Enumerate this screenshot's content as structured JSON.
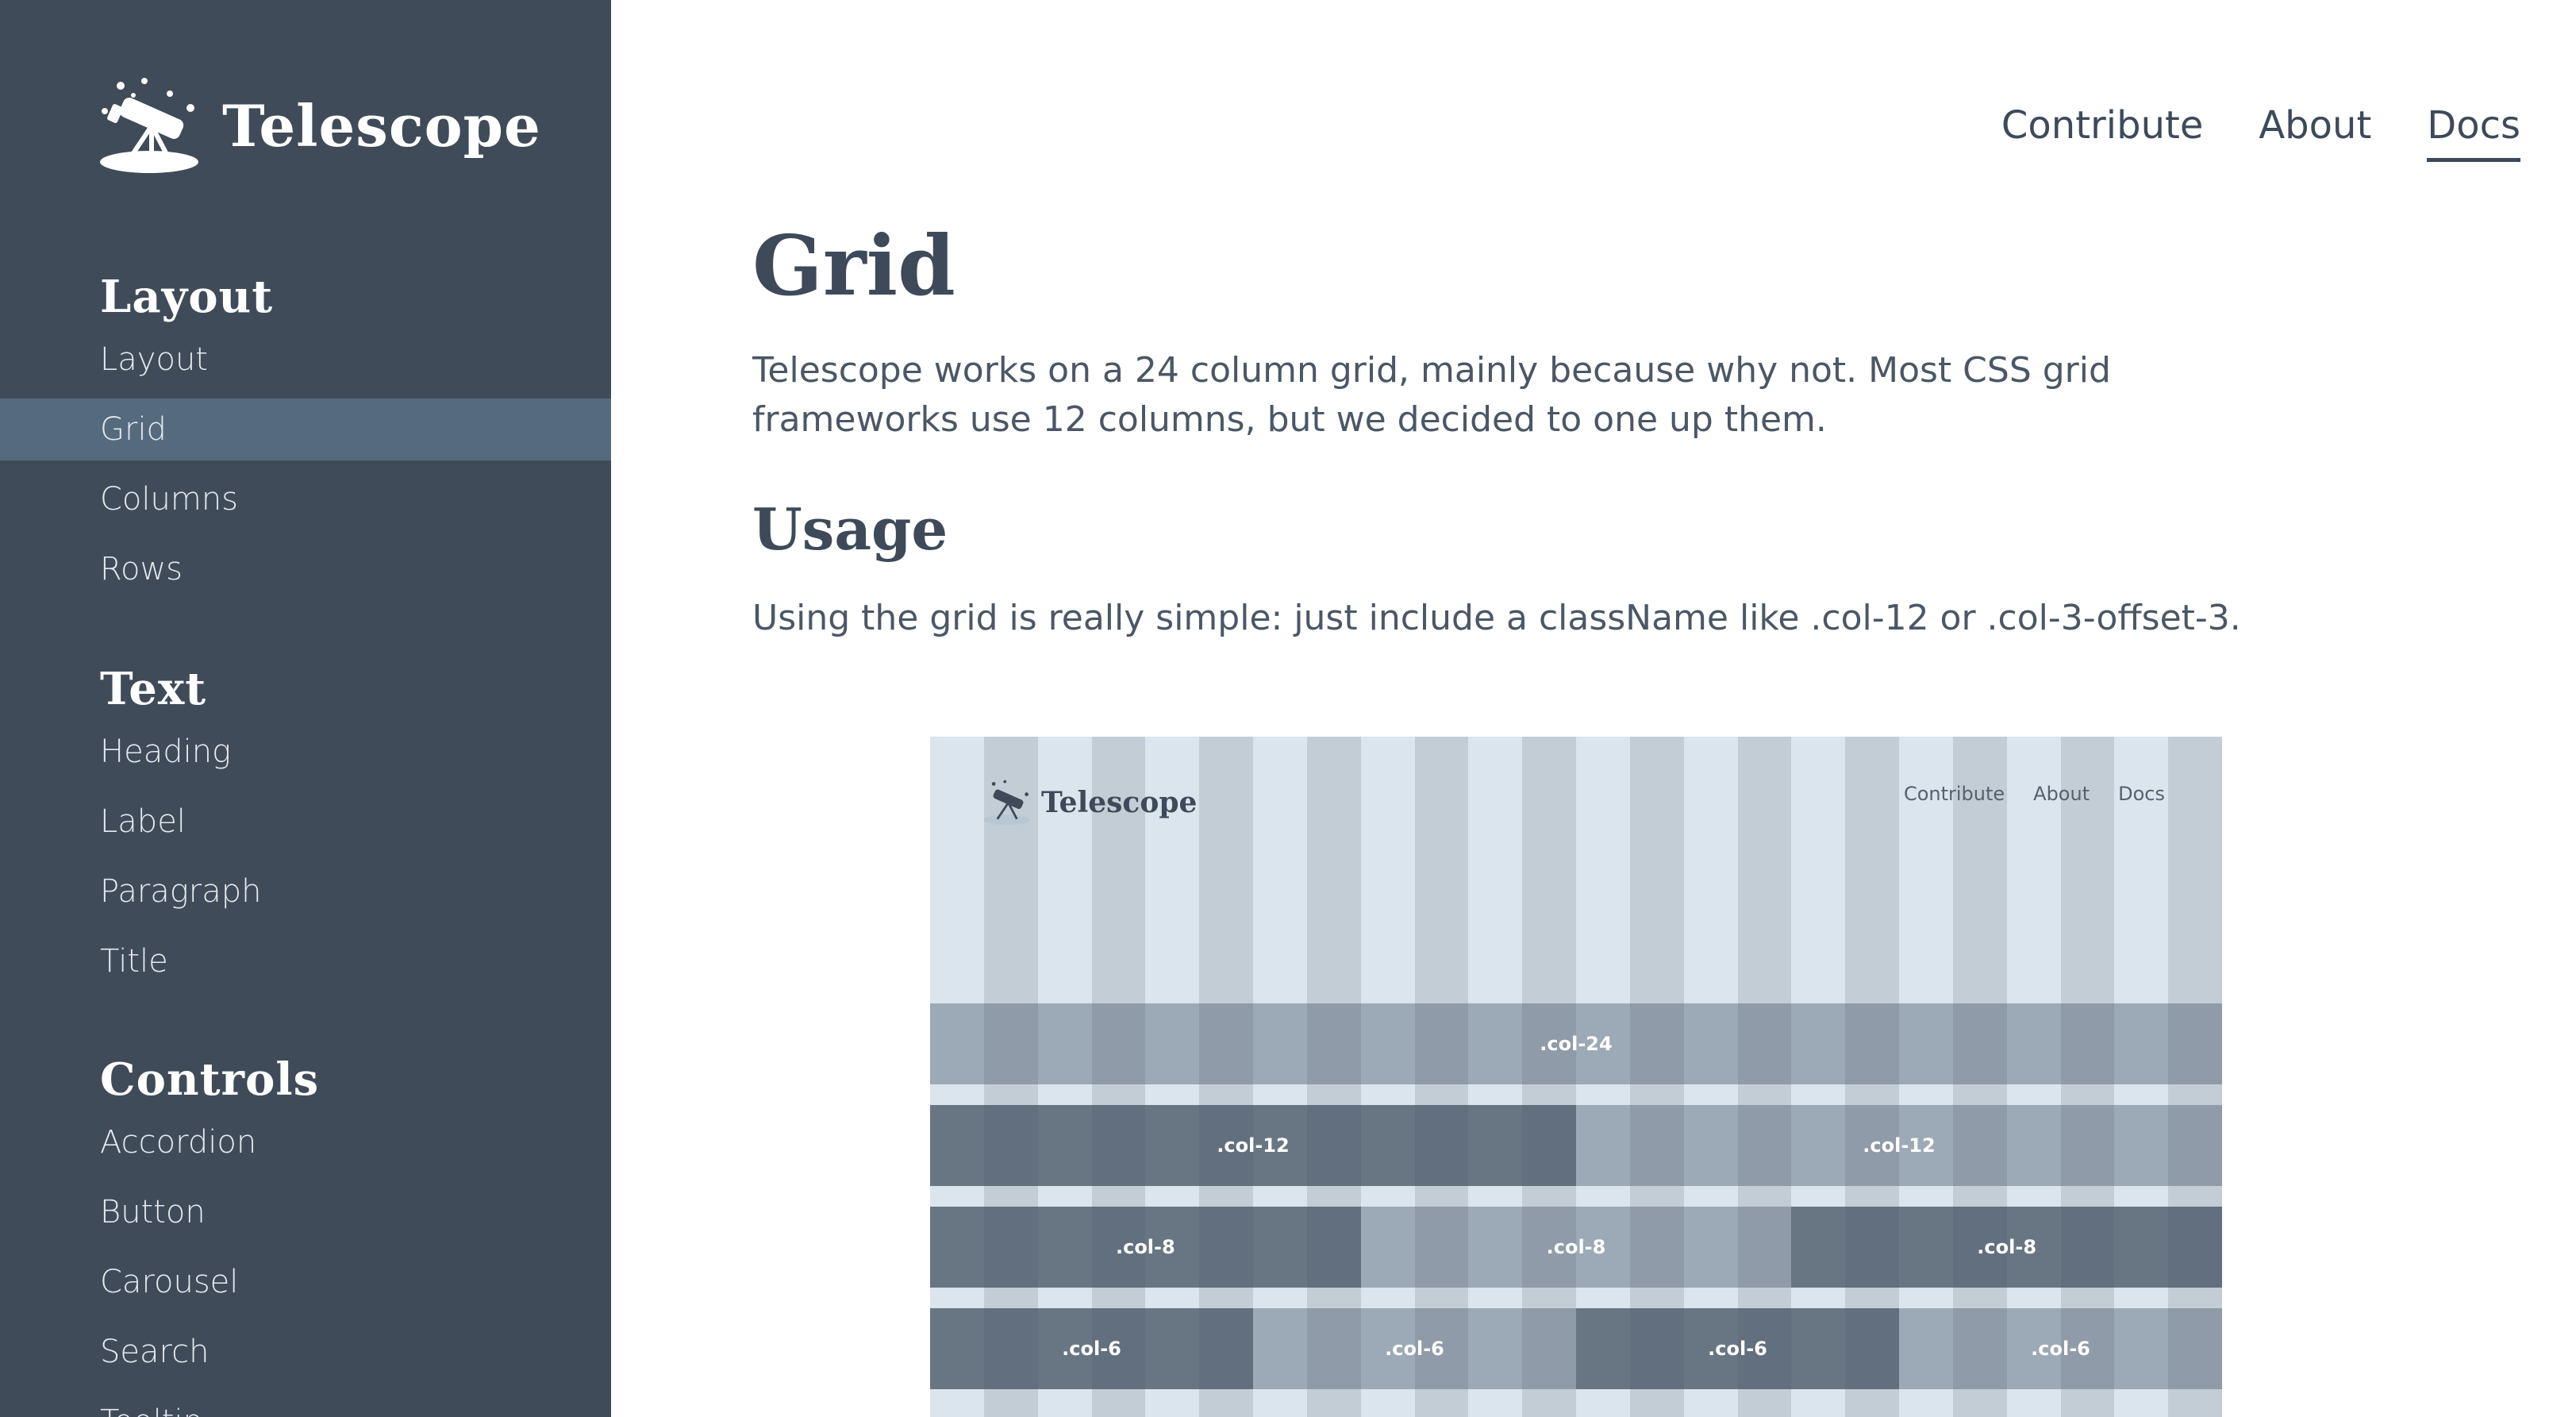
{
  "app": {
    "name": "Telescope"
  },
  "sidebar": {
    "groups": [
      {
        "heading": "Layout",
        "items": [
          "Layout",
          "Grid",
          "Columns",
          "Rows"
        ]
      },
      {
        "heading": "Text",
        "items": [
          "Heading",
          "Label",
          "Paragraph",
          "Title"
        ]
      },
      {
        "heading": "Controls",
        "items": [
          "Accordion",
          "Button",
          "Carousel",
          "Search",
          "Tooltip"
        ]
      }
    ],
    "active_item": "Grid"
  },
  "topnav": {
    "items": [
      "Contribute",
      "About",
      "Docs"
    ],
    "current": "Docs"
  },
  "main": {
    "title": "Grid",
    "intro": "Telescope works on a 24 column grid, mainly because why not. Most CSS grid frameworks use 12 columns, but we decided to one up them.",
    "usage_heading": "Usage",
    "usage_text": "Using the grid is really simple: just include a className like .col-12 or .col-3-offset-3."
  },
  "figure": {
    "logo_text": "Telescope",
    "nav": [
      "Contribute",
      "About",
      "Docs"
    ],
    "rows": [
      {
        "label": ".col-24",
        "cells": 1
      },
      {
        "label": ".col-12",
        "cells": 2
      },
      {
        "label": ".col-8",
        "cells": 3
      },
      {
        "label": ".col-6",
        "cells": 4
      }
    ]
  },
  "colors": {
    "sidebar_bg": "#3f4b59",
    "sidebar_active": "#566a7e",
    "text": "#3e4a5a",
    "grid_column": "#dae5ee",
    "grid_gutter": "#c3cdd6"
  }
}
